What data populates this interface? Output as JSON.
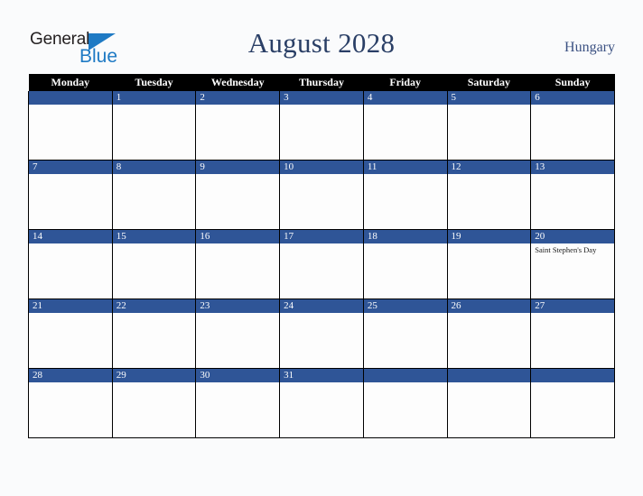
{
  "brand": {
    "logo_line1": "General",
    "logo_line2": "Blue",
    "logo_color_dark": "#231f20",
    "logo_color_blue": "#1e7ac4"
  },
  "header": {
    "title": "August 2028",
    "country": "Hungary",
    "title_color": "#2a3f66",
    "country_color": "#3b5182"
  },
  "calendar": {
    "accent_color": "#2f5597",
    "header_bg": "#000000",
    "weekday_headers": [
      "Monday",
      "Tuesday",
      "Wednesday",
      "Thursday",
      "Friday",
      "Saturday",
      "Sunday"
    ],
    "weeks": [
      [
        {
          "day": "",
          "events": []
        },
        {
          "day": "1",
          "events": []
        },
        {
          "day": "2",
          "events": []
        },
        {
          "day": "3",
          "events": []
        },
        {
          "day": "4",
          "events": []
        },
        {
          "day": "5",
          "events": []
        },
        {
          "day": "6",
          "events": []
        }
      ],
      [
        {
          "day": "7",
          "events": []
        },
        {
          "day": "8",
          "events": []
        },
        {
          "day": "9",
          "events": []
        },
        {
          "day": "10",
          "events": []
        },
        {
          "day": "11",
          "events": []
        },
        {
          "day": "12",
          "events": []
        },
        {
          "day": "13",
          "events": []
        }
      ],
      [
        {
          "day": "14",
          "events": []
        },
        {
          "day": "15",
          "events": []
        },
        {
          "day": "16",
          "events": []
        },
        {
          "day": "17",
          "events": []
        },
        {
          "day": "18",
          "events": []
        },
        {
          "day": "19",
          "events": []
        },
        {
          "day": "20",
          "events": [
            "Saint Stephen's Day"
          ]
        }
      ],
      [
        {
          "day": "21",
          "events": []
        },
        {
          "day": "22",
          "events": []
        },
        {
          "day": "23",
          "events": []
        },
        {
          "day": "24",
          "events": []
        },
        {
          "day": "25",
          "events": []
        },
        {
          "day": "26",
          "events": []
        },
        {
          "day": "27",
          "events": []
        }
      ],
      [
        {
          "day": "28",
          "events": []
        },
        {
          "day": "29",
          "events": []
        },
        {
          "day": "30",
          "events": []
        },
        {
          "day": "31",
          "events": []
        },
        {
          "day": "",
          "events": []
        },
        {
          "day": "",
          "events": []
        },
        {
          "day": "",
          "events": []
        }
      ]
    ]
  }
}
